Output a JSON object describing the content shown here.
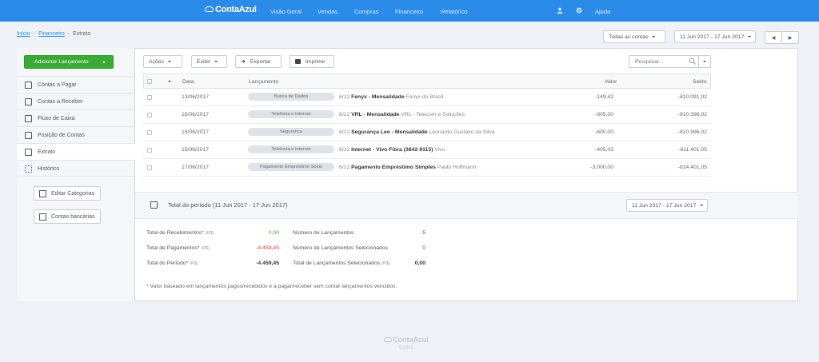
{
  "topbar": {
    "logo": "ContaAzul",
    "nav": [
      "Visão Geral",
      "Vendas",
      "Compras",
      "Financeiro",
      "Relatórios"
    ],
    "help": "Ajuda"
  },
  "breadcrumb": [
    "Início",
    "Financeiro",
    "Extrato"
  ],
  "header": {
    "accounts_select": "Todas as contas",
    "date_range": "11 Jun 2017 - 17 Jun 2017"
  },
  "sidebar": {
    "add_button": "Adicionar Lançamento",
    "items": [
      {
        "label": "Contas a Pagar",
        "icon": "payable-icon"
      },
      {
        "label": "Contas a Receber",
        "icon": "receivable-icon"
      },
      {
        "label": "Fluxo de Caixa",
        "icon": "cashflow-icon"
      },
      {
        "label": "Posição de Contas",
        "icon": "accounts-position-icon"
      },
      {
        "label": "Extrato",
        "icon": "statement-icon",
        "active": true
      },
      {
        "label": "Histórico",
        "icon": "history-icon"
      }
    ],
    "edit_categories": "Editar Categorias",
    "bank_accounts": "Contas bancárias"
  },
  "toolbar": {
    "actions": "Ações",
    "show": "Exibir",
    "export": "Exportar",
    "print": "Imprimir",
    "search_placeholder": "Pesquisar..."
  },
  "table": {
    "headers": {
      "date": "Data",
      "entry": "Lançamento",
      "value": "Valor",
      "balance": "Saldo"
    },
    "rows": [
      {
        "date": "13/06/2017",
        "category": "Busca de Dados",
        "installment": "6/12",
        "title": "Fenyx - Mensalidade",
        "contact": "Fenyx do Brasil",
        "value": "-149,42",
        "balance": "-810.091,02"
      },
      {
        "date": "15/06/2017",
        "category": "Telefonia e Internet",
        "installment": "6/12",
        "title": "VRL - Mensalidade",
        "contact": "VRL - Telecom e Soluções",
        "value": "-305,00",
        "balance": "-810.396,02"
      },
      {
        "date": "15/06/2017",
        "category": "Segurança",
        "installment": "6/12",
        "title": "Segurança Leo - Mensalidade",
        "contact": "Leonardo Gustavo da Silva",
        "value": "-600,00",
        "balance": "-810.996,02"
      },
      {
        "date": "15/06/2017",
        "category": "Telefonia e Internet",
        "installment": "6/12",
        "title": "Internet - Vivo Fibra (3842-9115)",
        "contact": "Vivo",
        "value": "-405,03",
        "balance": "-811.401,05"
      },
      {
        "date": "17/06/2017",
        "category": "Pagamento Empréstimo Sócio",
        "installment": "6/12",
        "title": "Pagamento Empréstimo Simples",
        "contact": "Paulo Hoffmann",
        "value": "-3.000,00",
        "balance": "-814.401,05"
      }
    ]
  },
  "summary": {
    "title": "Total do período (11 Jun 2017 - 17 Jun 2017)",
    "date_range": "11 Jun 2017 - 17 Jun 2017",
    "unit": "(R$)",
    "receipts_label": "Total de Recebimentos*",
    "receipts_value": "0,00",
    "payments_label": "Total de Pagamentos*",
    "payments_value": "-4.459,45",
    "period_label": "Total do Período*",
    "period_value": "-4.459,45",
    "count_label": "Número de Lançamentos",
    "count_value": "5",
    "selected_count_label": "Número de Lançamentos Selecionados",
    "selected_count_value": "0",
    "selected_total_label": "Total de Lançamentos Selecionados",
    "selected_total_value": "0,00",
    "footnote": "* Valor baseado em lançamentos pagos/recebidos e a pagar/receber sem contar lançamentos vencidos."
  },
  "footer": {
    "logo": "ContaAzul",
    "year": "©2016"
  },
  "colors": {
    "brand": "#2a8be8",
    "add": "#3aaa35",
    "positive": "#3aaa35",
    "negative": "#e53935"
  }
}
